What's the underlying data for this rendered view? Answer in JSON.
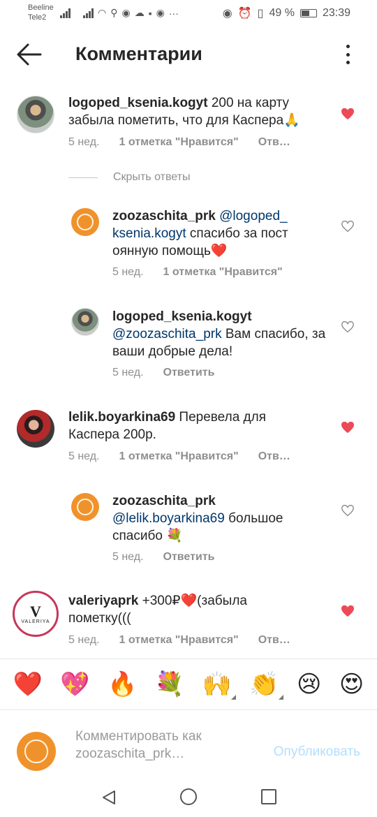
{
  "status_bar": {
    "carrier1": "Beeline",
    "carrier2": "Tele2",
    "battery": "49 %",
    "time": "23:39"
  },
  "header": {
    "title": "Комментарии",
    "back_icon": "arrow-left-icon",
    "more_icon": "more-vertical-icon"
  },
  "colors": {
    "heart_liked": "#ed4956",
    "mention": "#00376b",
    "post_button": "#b2dffc"
  },
  "comments": [
    {
      "user": "logoped_ksenia.kogyt",
      "text": " 200 на карту забыла пометить, что для Каспера🙏",
      "time": "5 нед.",
      "likes": "1 отметка \"Нравится\"",
      "reply": "Отв…",
      "liked": true
    },
    {
      "user": "lelik.boyarkina69",
      "text": " Перевела для Каспера 200р.",
      "time": "5 нед.",
      "likes": "1 отметка \"Нравится\"",
      "reply": "Отв…",
      "liked": true
    },
    {
      "user": "valeriyaprk",
      "text": " +300₽❤️(забыла пометку(((",
      "time": "5 нед.",
      "likes": "1 отметка \"Нравится\"",
      "reply": "Отв…",
      "liked": true
    }
  ],
  "hide_replies": "Скрыть ответы",
  "replies": [
    {
      "user": "zoozaschita_prk",
      "mention": "@logoped_ksenia.kogyt",
      "text": " спасибо за постоянную помощь❤️",
      "time": "5 нед.",
      "likes": "1 отметка \"Нравится\"",
      "liked": false
    },
    {
      "user": "logoped_ksenia.kogyt",
      "mention": "@zoozaschita_prk",
      "text": " Вам спасибо, за ваши добрые дела!",
      "time": "5 нед.",
      "reply": "Ответить",
      "liked": false
    },
    {
      "user": "zoozaschita_prk",
      "mention": "@lelik.boyarkina69",
      "text": " большое спасибо 💐",
      "time": "5 нед.",
      "reply": "Ответить",
      "liked": false
    }
  ],
  "valeriya_logo": "VALERIYA",
  "emoji_bar": [
    "❤️",
    "💖",
    "🔥",
    "💐",
    "🙌",
    "👏",
    "😢",
    "😍"
  ],
  "composer": {
    "placeholder": "Комментировать как zoozaschita_prk…",
    "post_label": "Опубликовать"
  }
}
